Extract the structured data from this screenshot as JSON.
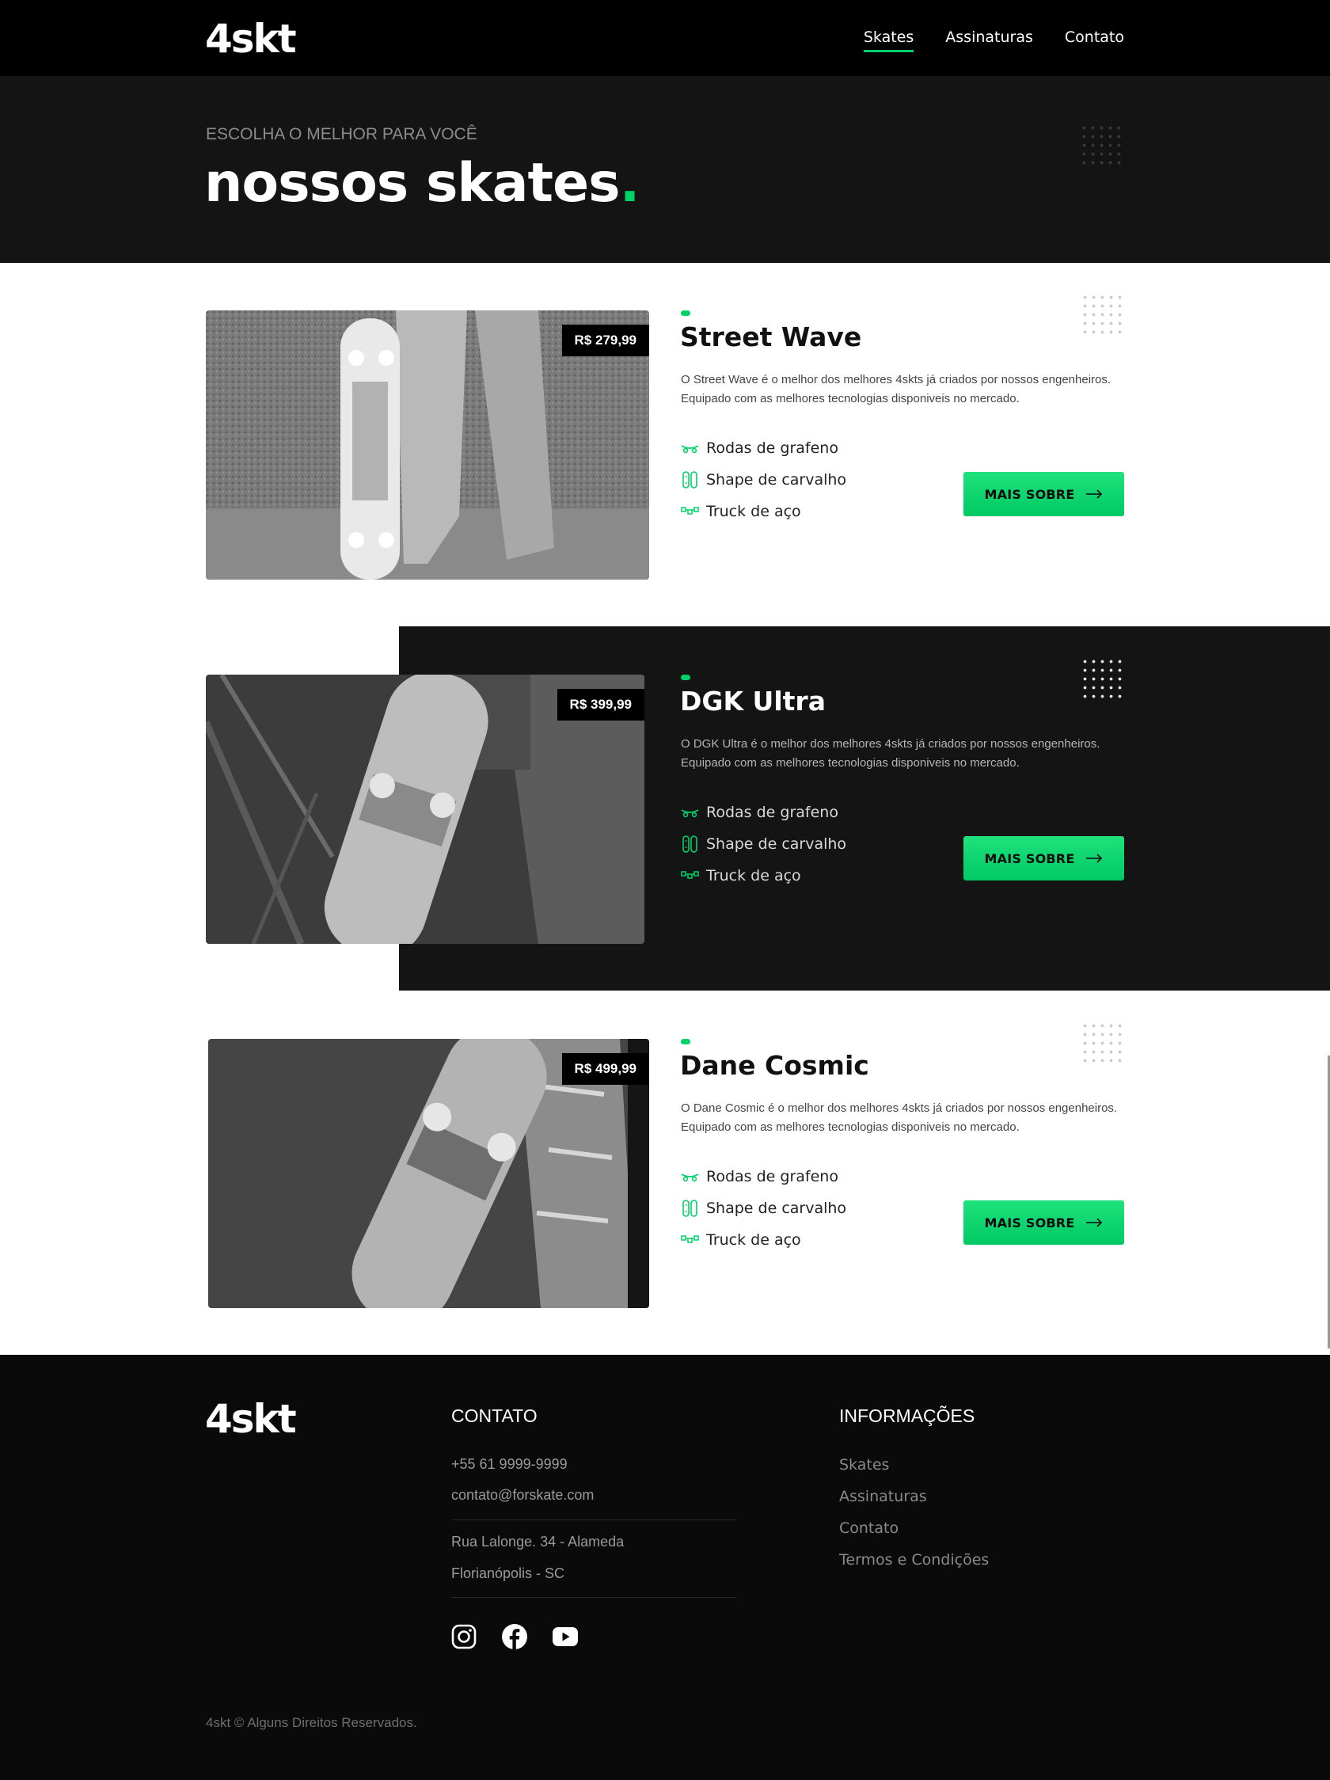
{
  "header": {
    "logo": "4skt",
    "nav": [
      {
        "label": "Skates",
        "active": true
      },
      {
        "label": "Assinaturas",
        "active": false
      },
      {
        "label": "Contato",
        "active": false
      }
    ]
  },
  "hero": {
    "kicker": "ESCOLHA O MELHOR PARA VOCÊ",
    "title": "nossos skates",
    "title_dot": "."
  },
  "products": [
    {
      "name": "Street Wave",
      "price": "R$ 279,99",
      "description": "O Street Wave é o melhor dos melhores 4skts já criados por nossos engenheiros. Equipado com as melhores tecnologias disponiveis no mercado.",
      "features": [
        {
          "label": "Rodas de grafeno",
          "icon": "skate-wheels-icon"
        },
        {
          "label": "Shape de carvalho",
          "icon": "skate-deck-icon"
        },
        {
          "label": "Truck de aço",
          "icon": "truck-icon"
        }
      ],
      "button": "MAIS SOBRE"
    },
    {
      "name": "DGK Ultra",
      "price": "R$ 399,99",
      "description": "O DGK Ultra é o melhor dos melhores 4skts já criados por nossos engenheiros. Equipado com as melhores tecnologias disponiveis no mercado.",
      "features": [
        {
          "label": "Rodas de grafeno",
          "icon": "skate-wheels-icon"
        },
        {
          "label": "Shape de carvalho",
          "icon": "skate-deck-icon"
        },
        {
          "label": "Truck de aço",
          "icon": "truck-icon"
        }
      ],
      "button": "MAIS SOBRE"
    },
    {
      "name": "Dane Cosmic",
      "price": "R$ 499,99",
      "description": "O Dane Cosmic é o melhor dos melhores 4skts já criados por nossos engenheiros. Equipado com as melhores tecnologias disponiveis no mercado.",
      "features": [
        {
          "label": "Rodas de grafeno",
          "icon": "skate-wheels-icon"
        },
        {
          "label": "Shape de carvalho",
          "icon": "skate-deck-icon"
        },
        {
          "label": "Truck de aço",
          "icon": "truck-icon"
        }
      ],
      "button": "MAIS SOBRE"
    }
  ],
  "footer": {
    "logo": "4skt",
    "contact": {
      "heading": "CONTATO",
      "phone": "+55 61 9999-9999",
      "email": "contato@forskate.com",
      "address1": "Rua Lalonge. 34 - Alameda",
      "address2": "Florianópolis - SC"
    },
    "info": {
      "heading": "INFORMAÇÕES",
      "links": [
        "Skates",
        "Assinaturas",
        "Contato",
        "Termos e Condições"
      ]
    },
    "social": [
      "instagram-icon",
      "facebook-icon",
      "youtube-icon"
    ],
    "copyright": "4skt © Alguns Direitos Reservados."
  },
  "colors": {
    "accent": "#00d26a",
    "dark": "#141414",
    "black": "#000000"
  }
}
